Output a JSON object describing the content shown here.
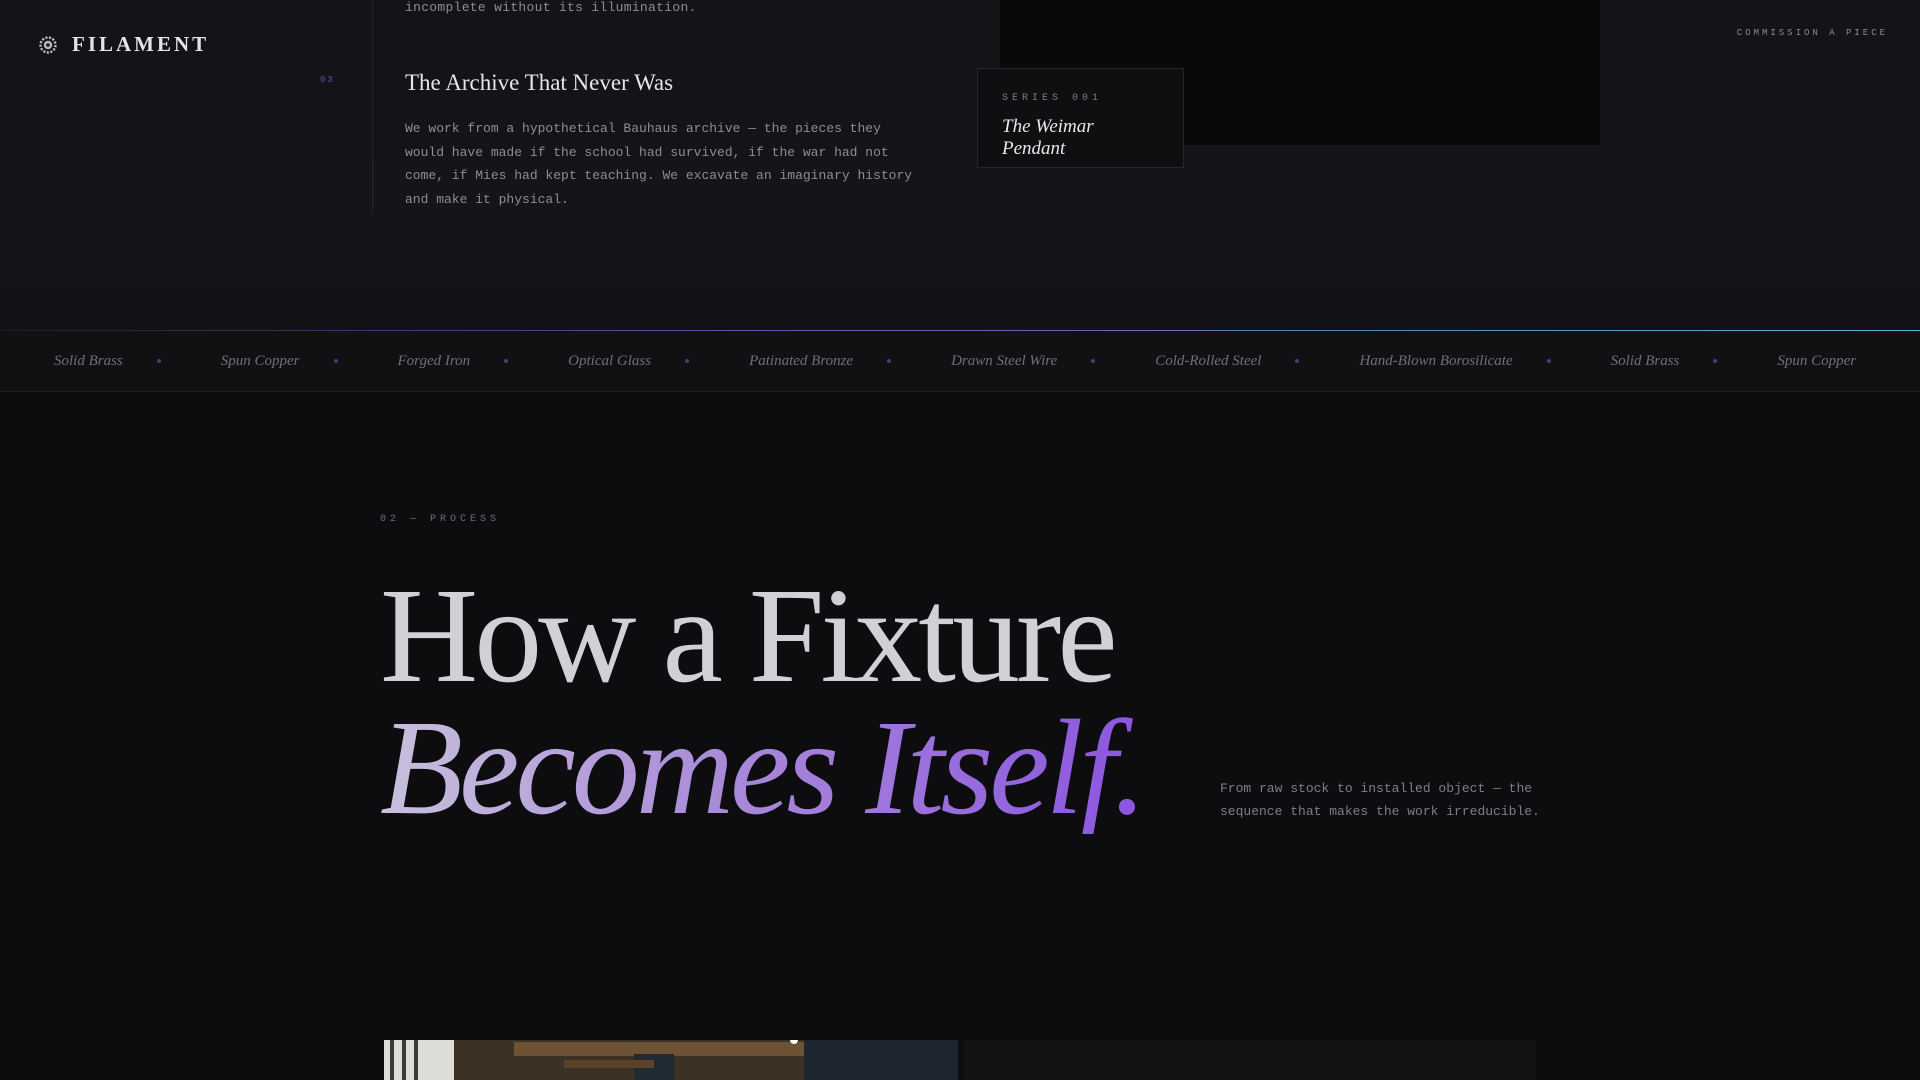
{
  "header": {
    "brand": "FILAMENT",
    "logo_icon": "gear-bulb-icon",
    "commission_label": "COMMISSION A PIECE"
  },
  "manifesto": {
    "previous_line": "incomplete without its illumination.",
    "item_number": "03",
    "item_title": "The Archive That Never Was",
    "item_body": "We work from a hypothetical Bauhaus archive — the pieces they would have made if the school had survived, if the war had not come, if Mies had kept teaching. We excavate an imaginary history and make it physical."
  },
  "series_card": {
    "label": "SERIES 001",
    "title": "The Weimar Pendant"
  },
  "materials": [
    "Solid Brass",
    "Spun Copper",
    "Forged Iron",
    "Optical Glass",
    "Patinated Bronze",
    "Drawn Steel Wire",
    "Cold-Rolled Steel",
    "Hand-Blown Borosilicate",
    "Solid Brass",
    "Spun Copper"
  ],
  "process": {
    "eyebrow": "02 — PROCESS",
    "headline_line1": "How a Fixture",
    "headline_line2": "Becomes Itself.",
    "subtext": "From raw stock to installed object — the sequence that makes the work irreducible."
  },
  "colors": {
    "accent_purple": "#8b55e0",
    "accent_teal": "#4fb8c4",
    "background": "#0d0d10"
  }
}
